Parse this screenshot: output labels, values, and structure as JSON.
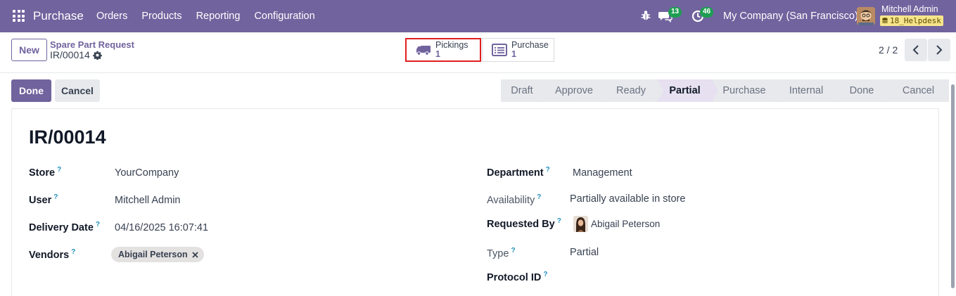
{
  "navbar": {
    "app_name": "Purchase",
    "menu": [
      "Orders",
      "Products",
      "Reporting",
      "Configuration"
    ],
    "messages_count": "13",
    "activities_count": "46",
    "company": "My Company (San Francisco)",
    "user_name": "Mitchell Admin",
    "database": "18_Helpdesk"
  },
  "control": {
    "new_label": "New",
    "breadcrumb": "Spare Part Request",
    "record": "IR/00014",
    "smart_buttons": [
      {
        "label": "Pickings",
        "count": "1"
      },
      {
        "label": "Purchase",
        "count": "1"
      }
    ],
    "pager": "2 / 2"
  },
  "actions": {
    "done_label": "Done",
    "cancel_label": "Cancel"
  },
  "statusbar": {
    "stages": [
      "Draft",
      "Approve",
      "Ready",
      "Partial",
      "Purchase",
      "Internal",
      "Done",
      "Cancel"
    ],
    "current": "Partial"
  },
  "form": {
    "title": "IR/00014",
    "help_mark": "?",
    "left": {
      "store_label": "Store",
      "store_value": "YourCompany",
      "user_label": "User",
      "user_value": "Mitchell Admin",
      "delivery_label": "Delivery Date",
      "delivery_value": "04/16/2025 16:07:41",
      "vendors_label": "Vendors",
      "vendor_tag": "Abigail Peterson"
    },
    "right": {
      "department_label": "Department",
      "department_value": "Management",
      "availability_label": "Availability",
      "availability_value": "Partially available in store",
      "requested_label": "Requested By",
      "requested_value": "Abigail Peterson",
      "type_label": "Type",
      "type_value": "Partial",
      "protocol_label": "Protocol ID"
    }
  },
  "colors": {
    "brand": "#71639e",
    "badge": "#1e9e52",
    "highlight": "#e02020"
  }
}
